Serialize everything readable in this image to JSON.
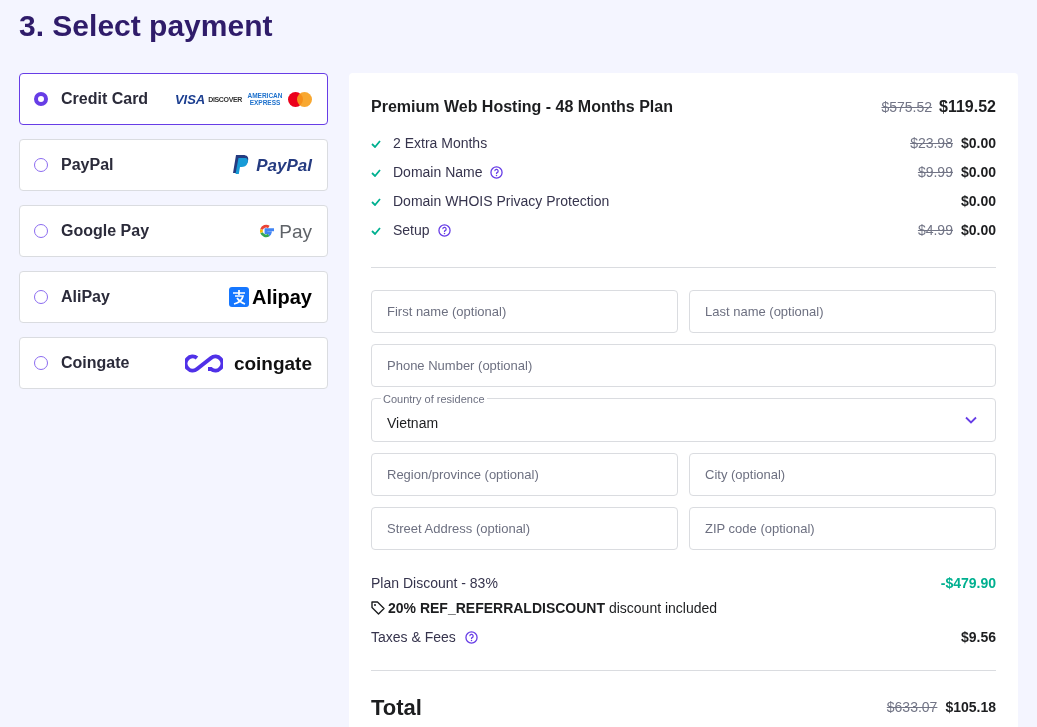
{
  "title": "3. Select payment",
  "payment_methods": [
    {
      "label": "Credit Card",
      "selected": true,
      "logo": {
        "kind": "cards",
        "texts": [
          "VISA",
          "DISCOVER",
          "AMERICAN EXPRESS"
        ]
      }
    },
    {
      "label": "PayPal",
      "selected": false,
      "logo": {
        "kind": "paypal",
        "texts": [
          "PayPal"
        ]
      }
    },
    {
      "label": "Google Pay",
      "selected": false,
      "logo": {
        "kind": "gpay",
        "texts": [
          "Pay"
        ]
      }
    },
    {
      "label": "AliPay",
      "selected": false,
      "logo": {
        "kind": "alipay",
        "texts": [
          "Alipay"
        ]
      }
    },
    {
      "label": "Coingate",
      "selected": false,
      "logo": {
        "kind": "coingate",
        "texts": [
          "coingate"
        ]
      }
    }
  ],
  "order": {
    "plan": {
      "name": "Premium Web Hosting - 48 Months Plan",
      "old_price": "$575.52",
      "price": "$119.52"
    },
    "items": [
      {
        "label": "2 Extra Months",
        "help": false,
        "old_price": "$23.98",
        "price": "$0.00"
      },
      {
        "label": "Domain Name",
        "help": true,
        "old_price": "$9.99",
        "price": "$0.00"
      },
      {
        "label": "Domain WHOIS Privacy Protection",
        "help": false,
        "price": "$0.00"
      },
      {
        "label": "Setup",
        "help": true,
        "old_price": "$4.99",
        "price": "$0.00"
      }
    ]
  },
  "form": [
    [
      {
        "placeholder": "First name (optional)"
      },
      {
        "placeholder": "Last name (optional)"
      }
    ],
    [
      {
        "placeholder": "Phone Number (optional)"
      }
    ],
    [
      {
        "kind": "select",
        "label": "Country of residence",
        "value": "Vietnam"
      }
    ],
    [
      {
        "placeholder": "Region/province (optional)"
      },
      {
        "placeholder": "City (optional)"
      }
    ],
    [
      {
        "placeholder": "Street Address (optional)"
      },
      {
        "placeholder": "ZIP code (optional)"
      }
    ]
  ],
  "summary": {
    "discount": {
      "label": "Plan Discount - 83%",
      "amount": "-$479.90"
    },
    "coupon": "**20% REF_REFERRALDISCOUNT** discount included",
    "taxes": {
      "label": "Taxes & Fees",
      "amount": "$9.56"
    },
    "total": {
      "label": "Total",
      "old_price": "$633.07",
      "price": "$105.18"
    }
  }
}
